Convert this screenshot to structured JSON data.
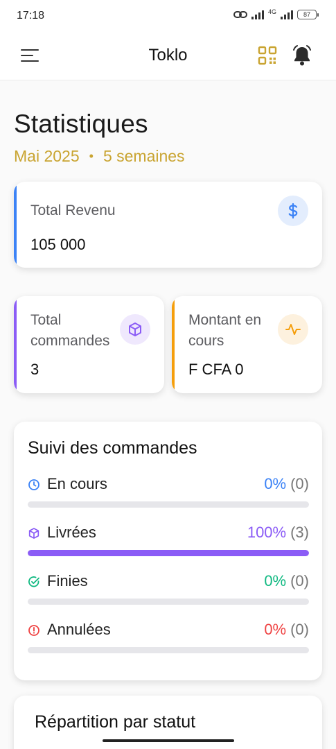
{
  "status_bar": {
    "time": "17:18",
    "network": "4G",
    "battery": "87"
  },
  "app_bar": {
    "title": "Toklo"
  },
  "page": {
    "title": "Statistiques",
    "period": "Mai 2025",
    "separator": "•",
    "duration": "5 semaines"
  },
  "cards": {
    "revenue": {
      "label": "Total Revenu",
      "value": "105 000",
      "icon": "dollar-icon",
      "accent": "#3b82f6"
    },
    "orders": {
      "label": "Total commandes",
      "value": "3",
      "icon": "box-icon",
      "accent": "#8b5cf6"
    },
    "pending": {
      "label": "Montant en cours",
      "value": "F CFA 0",
      "icon": "activity-icon",
      "accent": "#f59e0b"
    }
  },
  "tracking": {
    "title": "Suivi des commandes",
    "rows": [
      {
        "label": "En cours",
        "percent": "0%",
        "count": "(0)",
        "fraction": 0,
        "color": "#3b82f6",
        "icon": "clock-icon"
      },
      {
        "label": "Livrées",
        "percent": "100%",
        "count": "(3)",
        "fraction": 1,
        "color": "#8b5cf6",
        "icon": "box-icon"
      },
      {
        "label": "Finies",
        "percent": "0%",
        "count": "(0)",
        "fraction": 0,
        "color": "#10b981",
        "icon": "check-circle-icon"
      },
      {
        "label": "Annulées",
        "percent": "0%",
        "count": "(0)",
        "fraction": 0,
        "color": "#ef4444",
        "icon": "alert-circle-icon"
      }
    ]
  },
  "distribution": {
    "title": "Répartition par statut"
  },
  "colors": {
    "gold": "#c9a431",
    "qr": "#c9a431"
  }
}
